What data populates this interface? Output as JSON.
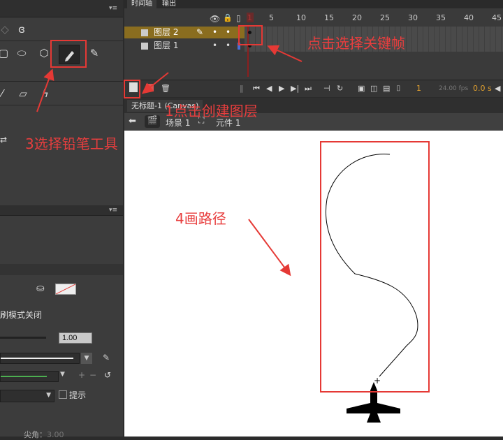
{
  "timeline": {
    "tabs": [
      "时间轴",
      "输出"
    ],
    "layers": [
      {
        "name": "图层 2"
      },
      {
        "name": "图层 1"
      }
    ],
    "frame_numbers": [
      "1",
      "5",
      "10",
      "15",
      "20",
      "25",
      "30",
      "35",
      "40",
      "45"
    ],
    "fps": "24.00 fps",
    "time": "0.0 s",
    "current_frame": "1"
  },
  "document": {
    "tab_title": "无标题-1 (Canvas)",
    "scene": "场景 1",
    "symbol": "元件 1"
  },
  "properties": {
    "mode_label": "刷模式关闭",
    "stroke_value": "1.00",
    "hint_label": "提示",
    "cap_label": "尖角：",
    "cap_value": "3.00"
  },
  "annotations": {
    "a1": "1点击创建图层",
    "a2": "点击选择关键帧",
    "a3": "3选择铅笔工具",
    "a4": "4画路径"
  },
  "colors": {
    "annotation_red": "#e53935",
    "layer_highlight": "#8a6d1f",
    "playhead": "#8b1f1f"
  }
}
